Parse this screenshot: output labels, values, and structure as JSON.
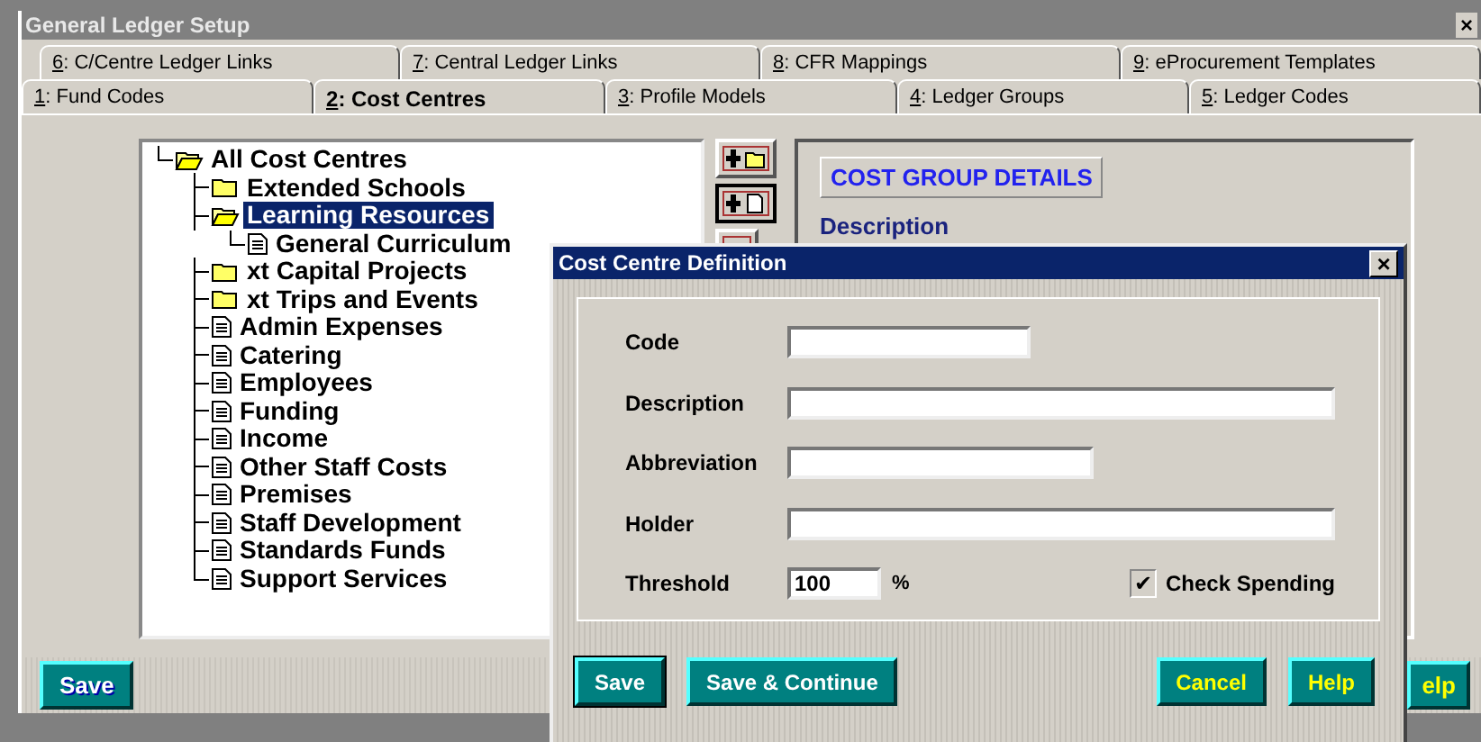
{
  "window": {
    "title": "General Ledger Setup",
    "close": "×"
  },
  "tab_rows": [
    [
      {
        "label": "6: C/Centre Ledger Links",
        "selected": false
      },
      {
        "label": "7: Central Ledger Links",
        "selected": false
      },
      {
        "label": "8: CFR Mappings",
        "selected": false
      },
      {
        "label": "9: eProcurement Templates",
        "selected": false
      }
    ],
    [
      {
        "label": "1: Fund Codes",
        "selected": false
      },
      {
        "label": "2: Cost Centres",
        "selected": true
      },
      {
        "label": "3: Profile Models",
        "selected": false
      },
      {
        "label": "4: Ledger Groups",
        "selected": false
      },
      {
        "label": "5: Ledger Codes",
        "selected": false
      }
    ]
  ],
  "tree": [
    {
      "label": "All Cost Centres",
      "kind": "folder",
      "expanded": true,
      "selected": false,
      "children": [
        {
          "label": "Extended Schools",
          "kind": "folder",
          "expanded": false,
          "selected": false
        },
        {
          "label": "Learning Resources",
          "kind": "folder",
          "expanded": true,
          "selected": true,
          "children": [
            {
              "label": "General Curriculum",
              "kind": "leaf",
              "selected": false
            }
          ]
        },
        {
          "label": "xt Capital Projects",
          "kind": "folder",
          "expanded": false,
          "selected": false
        },
        {
          "label": "xt Trips and Events",
          "kind": "folder",
          "expanded": false,
          "selected": false
        },
        {
          "label": "Admin Expenses",
          "kind": "leaf",
          "selected": false
        },
        {
          "label": "Catering",
          "kind": "leaf",
          "selected": false
        },
        {
          "label": "Employees",
          "kind": "leaf",
          "selected": false
        },
        {
          "label": "Funding",
          "kind": "leaf",
          "selected": false
        },
        {
          "label": "Income",
          "kind": "leaf",
          "selected": false
        },
        {
          "label": "Other Staff Costs",
          "kind": "leaf",
          "selected": false
        },
        {
          "label": "Premises",
          "kind": "leaf",
          "selected": false
        },
        {
          "label": "Staff Development",
          "kind": "leaf",
          "selected": false
        },
        {
          "label": "Standards Funds",
          "kind": "leaf",
          "selected": false
        },
        {
          "label": "Support Services",
          "kind": "leaf",
          "selected": false
        }
      ]
    }
  ],
  "details": {
    "heading": "COST GROUP DETAILS",
    "label": "Description"
  },
  "footer": {
    "save": "Save",
    "help": "elp"
  },
  "dialog": {
    "title": "Cost Centre Definition",
    "close": "×",
    "fields": [
      {
        "label": "Code",
        "kind": "short"
      },
      {
        "label": "Description",
        "kind": "long"
      },
      {
        "label": "Abbreviation",
        "kind": "medium"
      },
      {
        "label": "Holder",
        "kind": "long"
      }
    ],
    "threshold": {
      "label": "Threshold",
      "value": "100",
      "unit": "%"
    },
    "check": {
      "label": "Check Spending",
      "checked": true,
      "mark": "✔"
    },
    "buttons": [
      {
        "label": "Save",
        "kind": "confirm",
        "default": true
      },
      {
        "label": "Save & Continue",
        "kind": "confirm",
        "default": false
      },
      {
        "label": "Cancel",
        "kind": "other",
        "default": false
      },
      {
        "label": "Help",
        "kind": "other",
        "default": false
      }
    ]
  }
}
